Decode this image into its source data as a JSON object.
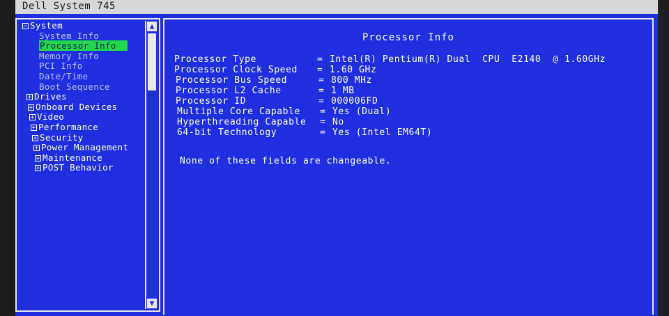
{
  "window": {
    "title": "Dell System 745"
  },
  "tree": {
    "items": [
      {
        "label": "System",
        "toggle": "−",
        "child": false,
        "selected": false
      },
      {
        "label": "System Info",
        "toggle": "",
        "child": true,
        "selected": false
      },
      {
        "label": "Processor Info",
        "toggle": "",
        "child": true,
        "selected": true
      },
      {
        "label": "Memory Info",
        "toggle": "",
        "child": true,
        "selected": false
      },
      {
        "label": "PCI Info",
        "toggle": "",
        "child": true,
        "selected": false
      },
      {
        "label": "Date/Time",
        "toggle": "",
        "child": true,
        "selected": false
      },
      {
        "label": "Boot Sequence",
        "toggle": "",
        "child": true,
        "selected": false
      },
      {
        "label": "Drives",
        "toggle": "+",
        "child": false,
        "selected": false
      },
      {
        "label": "Onboard Devices",
        "toggle": "+",
        "child": false,
        "selected": false
      },
      {
        "label": "Video",
        "toggle": "+",
        "child": false,
        "selected": false
      },
      {
        "label": "Performance",
        "toggle": "+",
        "child": false,
        "selected": false
      },
      {
        "label": "Security",
        "toggle": "+",
        "child": false,
        "selected": false
      },
      {
        "label": "Power Management",
        "toggle": "+",
        "child": false,
        "selected": false
      },
      {
        "label": "Maintenance",
        "toggle": "+",
        "child": false,
        "selected": false
      },
      {
        "label": "POST Behavior",
        "toggle": "+",
        "child": false,
        "selected": false
      }
    ],
    "scroll_up": "▲",
    "scroll_down": "▼"
  },
  "info": {
    "title": "Processor Info",
    "separator": "=",
    "rows": [
      {
        "label": "Processor Type",
        "value": "Intel(R) Pentium(R) Dual  CPU  E2140  @ 1.60GHz"
      },
      {
        "label": "Processor Clock Speed",
        "value": "1.60 GHz"
      },
      {
        "label": "Processor Bus Speed",
        "value": "800 MHz"
      },
      {
        "label": "Processor L2 Cache",
        "value": "1 MB"
      },
      {
        "label": "Processor ID",
        "value": "000006FD"
      },
      {
        "label": "Multiple Core Capable",
        "value": "Yes (Dual)"
      },
      {
        "label": "Hyperthreading Capable",
        "value": "No"
      },
      {
        "label": "64-bit Technology",
        "value": "Yes (Intel EM64T)"
      }
    ],
    "note": "None of these fields are changeable."
  },
  "colors": {
    "background": "#1f2fe0",
    "selection": "#22d84a",
    "text": "#ffffff"
  }
}
